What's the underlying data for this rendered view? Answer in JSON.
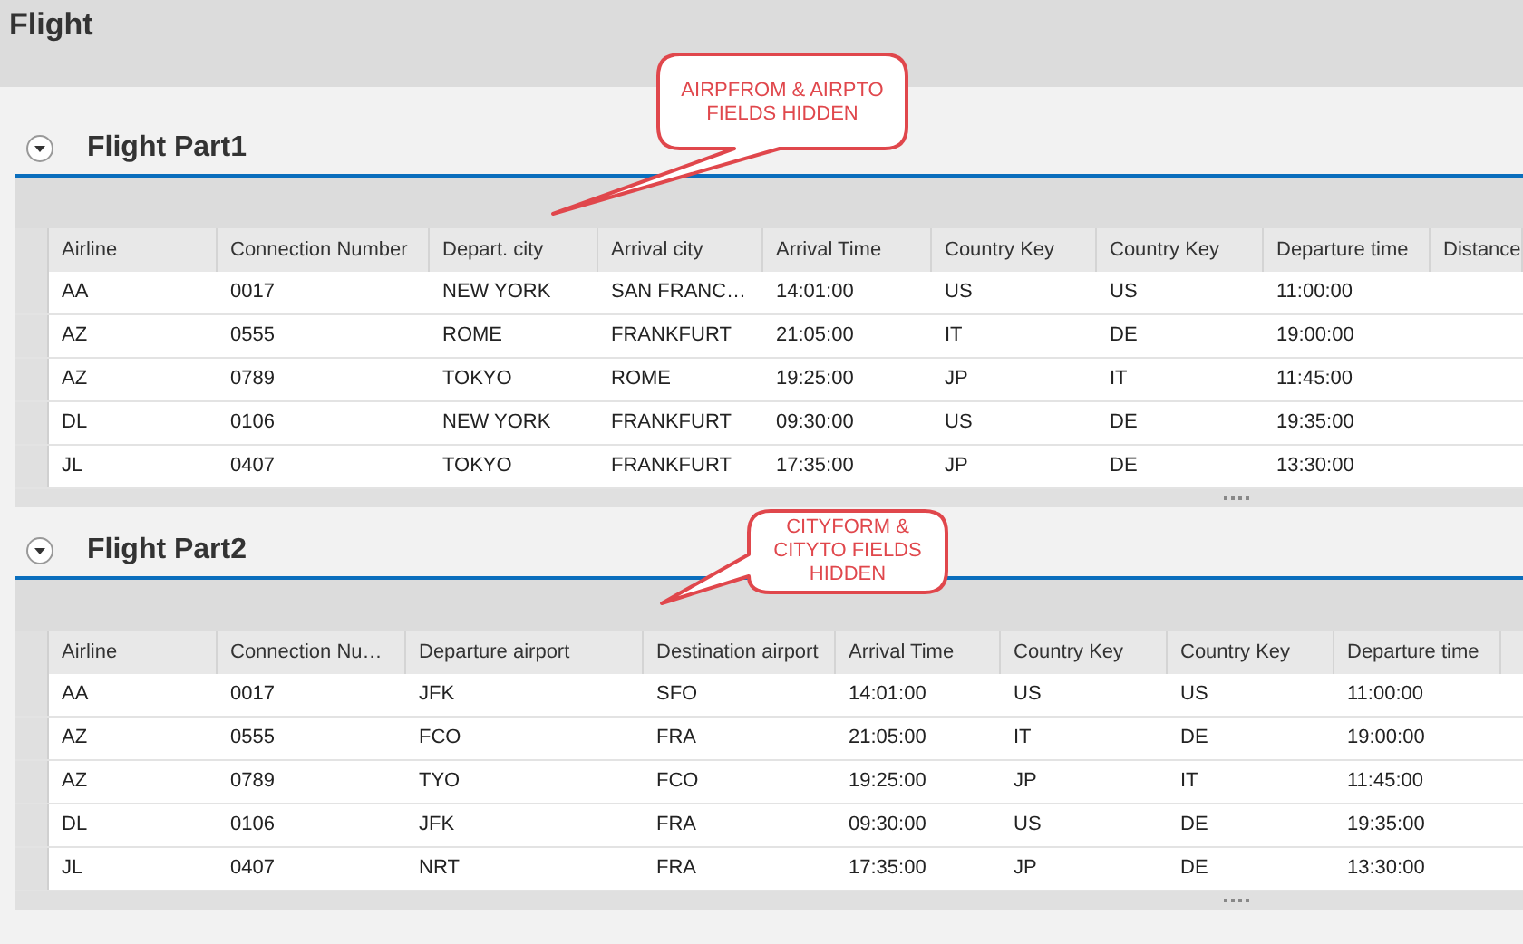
{
  "page": {
    "title": "Flight"
  },
  "sections": [
    {
      "title": "Flight Part1",
      "expanded": true,
      "callout": "AIRPFROM & AIRPTO FIELDS HIDDEN",
      "columns": [
        "Airline",
        "Connection Number",
        "Depart. city",
        "Arrival city",
        "Arrival Time",
        "Country Key",
        "Country Key",
        "Departure time",
        "Distance"
      ],
      "rows": [
        [
          "AA",
          "0017",
          "NEW YORK",
          "SAN FRANC…",
          "14:01:00",
          "US",
          "US",
          "11:00:00"
        ],
        [
          "AZ",
          "0555",
          "ROME",
          "FRANKFURT",
          "21:05:00",
          "IT",
          "DE",
          "19:00:00"
        ],
        [
          "AZ",
          "0789",
          "TOKYO",
          "ROME",
          "19:25:00",
          "JP",
          "IT",
          "11:45:00"
        ],
        [
          "DL",
          "0106",
          "NEW YORK",
          "FRANKFURT",
          "09:30:00",
          "US",
          "DE",
          "19:35:00"
        ],
        [
          "JL",
          "0407",
          "TOKYO",
          "FRANKFURT",
          "17:35:00",
          "JP",
          "DE",
          "13:30:00"
        ]
      ]
    },
    {
      "title": "Flight Part2",
      "expanded": true,
      "callout": "CITYFORM & CITYTO FIELDS HIDDEN",
      "columns": [
        "Airline",
        "Connection Nu…",
        "Departure airport",
        "Destination airport",
        "Arrival Time",
        "Country Key",
        "Country Key",
        "Departure time"
      ],
      "rows": [
        [
          "AA",
          "0017",
          "JFK",
          "SFO",
          "14:01:00",
          "US",
          "US",
          "11:00:00"
        ],
        [
          "AZ",
          "0555",
          "FCO",
          "FRA",
          "21:05:00",
          "IT",
          "DE",
          "19:00:00"
        ],
        [
          "AZ",
          "0789",
          "TYO",
          "FCO",
          "19:25:00",
          "JP",
          "IT",
          "11:45:00"
        ],
        [
          "DL",
          "0106",
          "JFK",
          "FRA",
          "09:30:00",
          "US",
          "DE",
          "19:35:00"
        ],
        [
          "JL",
          "0407",
          "NRT",
          "FRA",
          "17:35:00",
          "JP",
          "DE",
          "13:30:00"
        ]
      ]
    }
  ]
}
